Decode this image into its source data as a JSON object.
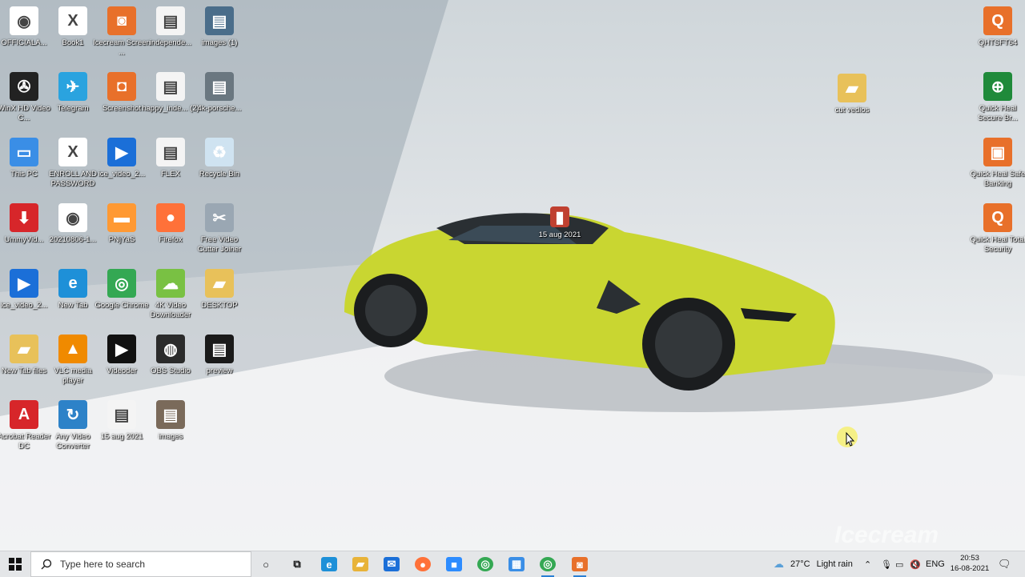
{
  "desktop": {
    "icons": [
      {
        "label": "OFFICIALA...",
        "icon": "disc-icon",
        "color": "#ffffff"
      },
      {
        "label": "Book1",
        "icon": "excel-file-icon",
        "color": "#ffffff"
      },
      {
        "label": "Icecream Screen ...",
        "icon": "icecream-recorder-icon",
        "color": "#e8702a"
      },
      {
        "label": "independe...",
        "icon": "image-file-icon",
        "color": "#f4f4f4"
      },
      {
        "label": "images (1)",
        "icon": "image-file-icon",
        "color": "#4a6d8a"
      },
      {
        "label": "WinX HD Video C...",
        "icon": "film-reel-icon",
        "color": "#222222"
      },
      {
        "label": "Telegram",
        "icon": "telegram-icon",
        "color": "#2aa3df"
      },
      {
        "label": "Screenshot",
        "icon": "camera-icon",
        "color": "#e8702a"
      },
      {
        "label": "happy_inde... (2)",
        "icon": "image-file-icon",
        "color": "#f4f4f4"
      },
      {
        "label": "4k-porsche...",
        "icon": "image-file-icon",
        "color": "#6a7780"
      },
      {
        "label": "This PC",
        "icon": "computer-icon",
        "color": "#3a8ee6"
      },
      {
        "label": "ENROLL AND PASSWORD",
        "icon": "excel-file-icon",
        "color": "#ffffff"
      },
      {
        "label": "ice_video_2...",
        "icon": "video-file-icon",
        "color": "#1b6fd8"
      },
      {
        "label": "FLEX",
        "icon": "image-file-icon",
        "color": "#f4f4f4"
      },
      {
        "label": "Recycle Bin",
        "icon": "recycle-bin-icon",
        "color": "#cfe3f1"
      },
      {
        "label": "UmmyVid...",
        "icon": "download-icon",
        "color": "#d7262a"
      },
      {
        "label": "20210806-1...",
        "icon": "disc-icon",
        "color": "#ffffff"
      },
      {
        "label": "PNjYaS",
        "icon": "flag-image-icon",
        "color": "#ff9933"
      },
      {
        "label": "Firefox",
        "icon": "firefox-icon",
        "color": "#ff7139"
      },
      {
        "label": "Free Video Cutter Joiner",
        "icon": "scissors-icon",
        "color": "#9aa7b3"
      },
      {
        "label": "ice_video_2...",
        "icon": "video-file-icon",
        "color": "#1b6fd8"
      },
      {
        "label": "New Tab",
        "icon": "edge-icon",
        "color": "#1e90d8"
      },
      {
        "label": "Google Chrome",
        "icon": "chrome-icon",
        "color": "#34a853"
      },
      {
        "label": "4K Video Downloader",
        "icon": "cloud-download-icon",
        "color": "#79c143"
      },
      {
        "label": "DESKTOP",
        "icon": "folder-icon",
        "color": "#e8c15a"
      },
      {
        "label": "New Tab files",
        "icon": "folder-icon",
        "color": "#e8c15a"
      },
      {
        "label": "VLC media player",
        "icon": "vlc-cone-icon",
        "color": "#f08a00"
      },
      {
        "label": "Videoder",
        "icon": "play-icon",
        "color": "#111111"
      },
      {
        "label": "OBS Studio",
        "icon": "obs-icon",
        "color": "#2b2b2b"
      },
      {
        "label": "preview",
        "icon": "image-file-icon",
        "color": "#1a1a1a"
      },
      {
        "label": "Acrobat Reader DC",
        "icon": "acrobat-icon",
        "color": "#d7262a"
      },
      {
        "label": "Any Video Converter",
        "icon": "video-converter-icon",
        "color": "#2d82c8"
      },
      {
        "label": "15 aug 2021",
        "icon": "image-file-icon",
        "color": "#f4f4f4"
      },
      {
        "label": "images",
        "icon": "image-file-icon",
        "color": "#7a6a5a"
      }
    ],
    "right_icons": [
      {
        "label": "QHTSFT64",
        "icon": "quick-heal-icon",
        "color": "#e8702a"
      },
      {
        "label": "Quick Heal Secure Br...",
        "icon": "globe-shield-icon",
        "color": "#1f8a3a"
      },
      {
        "label": "Quick Heal Safe Banking",
        "icon": "safe-banking-icon",
        "color": "#e8702a"
      },
      {
        "label": "Quick Heal Total Security",
        "icon": "quick-heal-q-icon",
        "color": "#e8702a"
      }
    ],
    "floating_icons": [
      {
        "label": "cut vedios",
        "icon": "folder-icon",
        "color": "#e8c15a"
      },
      {
        "label": "15 aug 2021",
        "icon": "folder-icon",
        "color": "#c04030"
      }
    ],
    "wallpaper_car_color": "#c9d631"
  },
  "taskbar": {
    "search_placeholder": "Type here to search",
    "apps": [
      {
        "name": "cortana-icon"
      },
      {
        "name": "task-view-icon"
      },
      {
        "name": "edge-icon",
        "color": "#1e90d8"
      },
      {
        "name": "file-explorer-icon",
        "color": "#e8b339"
      },
      {
        "name": "mail-icon",
        "color": "#1b6fd8"
      },
      {
        "name": "firefox-icon",
        "color": "#ff7139"
      },
      {
        "name": "zoom-icon",
        "color": "#2d8cff"
      },
      {
        "name": "chrome-icon",
        "color": "#34a853"
      },
      {
        "name": "control-panel-icon",
        "color": "#3a8ee6"
      },
      {
        "name": "chrome-icon",
        "color": "#34a853"
      },
      {
        "name": "icecream-recorder-icon",
        "color": "#e8702a"
      }
    ],
    "weather_temp": "27°C",
    "weather_text": "Light rain",
    "language": "ENG",
    "time": "20:53",
    "date": "16-08-2021"
  },
  "watermark": "Icecream"
}
